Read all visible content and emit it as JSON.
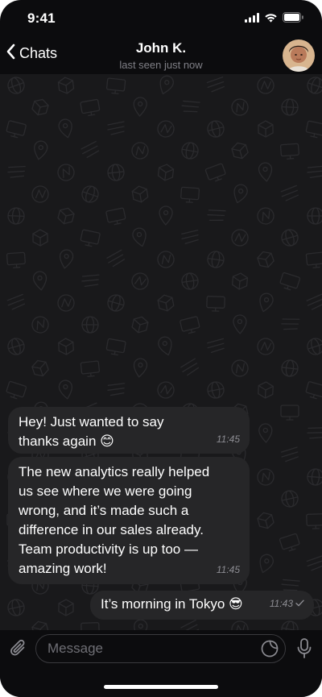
{
  "status_bar": {
    "time": "9:41",
    "icons": [
      "cellular-signal-icon",
      "wifi-icon",
      "battery-icon"
    ]
  },
  "header": {
    "back_label": "Chats",
    "contact_name": "John K.",
    "last_seen": "last seen just now",
    "avatar": "contact-avatar"
  },
  "messages": [
    {
      "direction": "incoming",
      "text": "Hey! Just wanted to say\nthanks again 😊",
      "time": "11:45"
    },
    {
      "direction": "incoming",
      "text": "The new analytics really helped\nus see where we were going\nwrong, and it’s made such a\ndifference in our sales already.\nTeam productivity is up too —\namazing work!",
      "time": "11:45"
    },
    {
      "direction": "outgoing",
      "text": "It’s morning in Tokyo 😎",
      "time": "11:43",
      "status": "sent-check-icon"
    }
  ],
  "input": {
    "placeholder": "Message",
    "value": "",
    "icons": [
      "paperclip-icon",
      "sticker-icon",
      "microphone-icon"
    ]
  },
  "colors": {
    "background": "#0c0c0e",
    "chat_background": "#19191b",
    "bubble": "#262628",
    "secondary_text": "#7f7f86"
  }
}
